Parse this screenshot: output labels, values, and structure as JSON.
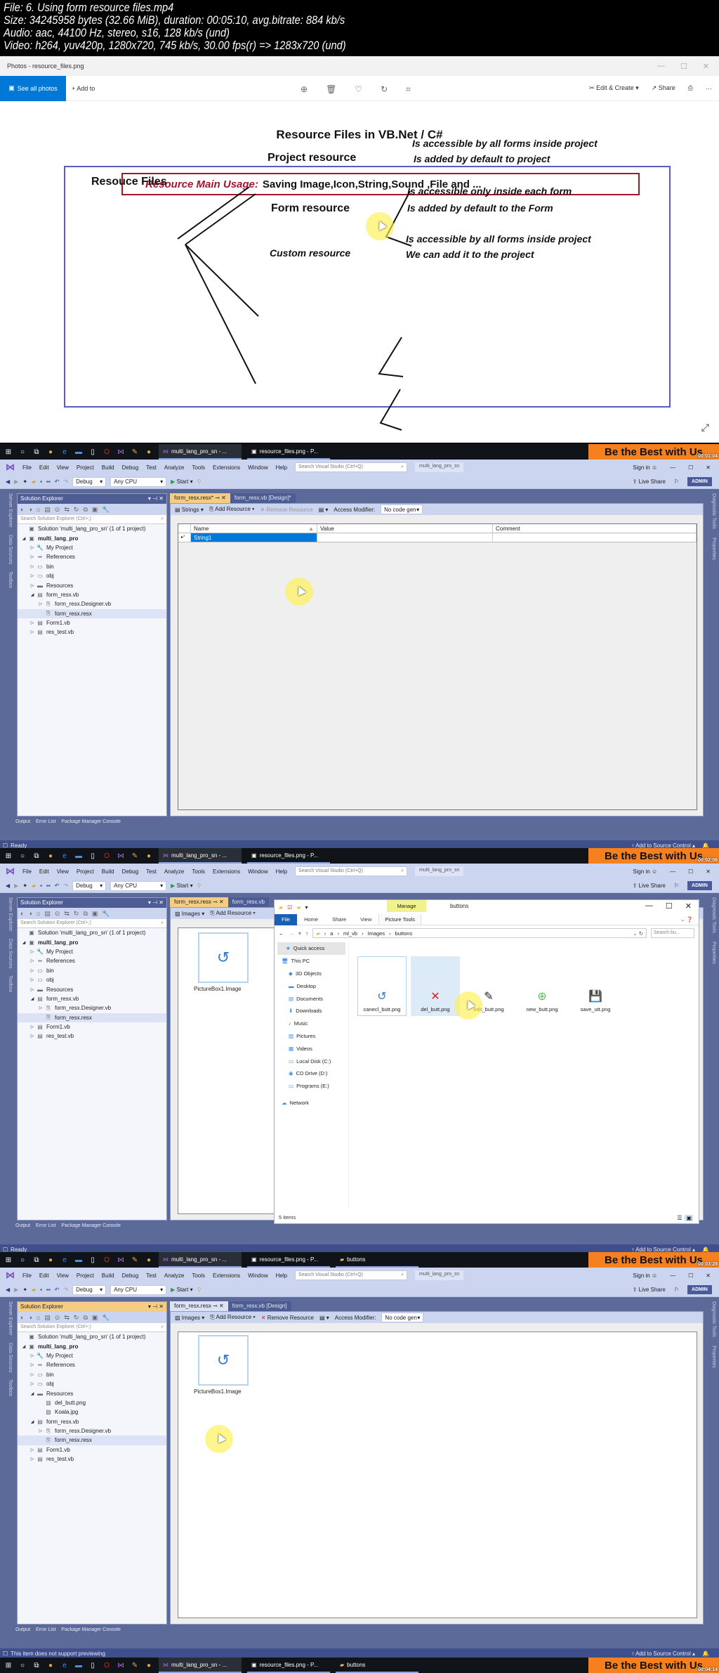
{
  "video_info": {
    "line1": "File: 6. Using form resource files.mp4",
    "line2": "Size: 34245958 bytes (32.66 MiB), duration: 00:05:10, avg.bitrate: 884 kb/s",
    "line3": "Audio: aac, 44100 Hz, stereo, s16, 128 kb/s (und)",
    "line4": "Video: h264, yuv420p, 1280x720, 745 kb/s, 30.00 fps(r) => 1283x720 (und)"
  },
  "photos": {
    "title": "Photos - resource_files.png",
    "see_all": "See all photos",
    "add_to": "+ Add to",
    "edit_create": "Edit & Create",
    "share": "Share",
    "more": "···"
  },
  "slide": {
    "title": "Resource Files in VB.Net / C#",
    "usage_label": "Resource Main Usage:",
    "usage_text": "Saving Image,Icon,String,Sound ,File and  ...",
    "root": "Resouce Files",
    "branches": [
      {
        "name": "Project resource",
        "notes": [
          "Is accessible  by  all forms inside project",
          "Is added by default to project"
        ]
      },
      {
        "name": "Form resource",
        "notes": [
          "Is accessible only inside each form",
          "Is added by default to the Form"
        ]
      },
      {
        "name": "Custom resource",
        "notes": [
          "Is accessible  by  all forms inside project",
          "We can add it to the project"
        ]
      }
    ]
  },
  "taskbar": {
    "apps": [
      "multi_lang_pro_sn - ...",
      "resource_files.png - P...",
      "buttons"
    ],
    "promo": "Be the Best with Us",
    "timestamps": [
      "00:01:04",
      "00:02:06",
      "00:03:28",
      "00:04:14"
    ]
  },
  "vs": {
    "menu": [
      "File",
      "Edit",
      "View",
      "Project",
      "Build",
      "Debug",
      "Test",
      "Analyze",
      "Tools",
      "Extensions",
      "Window",
      "Help"
    ],
    "search_placeholder": "Search Visual Studio (Ctrl+Q)",
    "solution_name": "multi_lang_pro_sn",
    "sign_in": "Sign in",
    "config": "Debug",
    "platform": "Any CPU",
    "start": "Start",
    "live_share": "Live Share",
    "admin": "ADMIN",
    "side_left": [
      "Server Explorer",
      "Data Sources",
      "Toolbox"
    ],
    "side_right": [
      "Diagnostic Tools",
      "Properties"
    ],
    "solution_explorer": "Solution Explorer",
    "se_search": "Search Solution Explorer (Ctrl+;)",
    "bottom_tabs": [
      "Output",
      "Error List",
      "Package Manager Console"
    ],
    "add_source": "Add to Source Control",
    "tree1": [
      {
        "label": "Solution 'multi_lang_pro_sn' (1 of 1 project)",
        "indent": 0,
        "tw": "",
        "icon": "▣"
      },
      {
        "label": "multi_lang_pro",
        "indent": 0,
        "tw": "◢",
        "icon": "▣",
        "bold": true
      },
      {
        "label": "My Project",
        "indent": 1,
        "tw": "▷",
        "icon": "🔧"
      },
      {
        "label": "References",
        "indent": 1,
        "tw": "▷",
        "icon": "▪▪"
      },
      {
        "label": "bin",
        "indent": 1,
        "tw": "▷",
        "icon": "▭"
      },
      {
        "label": "obj",
        "indent": 1,
        "tw": "▷",
        "icon": "▭"
      },
      {
        "label": "Resources",
        "indent": 1,
        "tw": "▷",
        "icon": "▬"
      },
      {
        "label": "form_resx.vb",
        "indent": 1,
        "tw": "◢",
        "icon": "▤"
      },
      {
        "label": "form_resx.Designer.vb",
        "indent": 2,
        "tw": "▷",
        "icon": "⎘"
      },
      {
        "label": "form_resx.resx",
        "indent": 2,
        "tw": "",
        "icon": "⎘",
        "sel": true
      },
      {
        "label": "Form1.vb",
        "indent": 1,
        "tw": "▷",
        "icon": "▤"
      },
      {
        "label": "res_test.vb",
        "indent": 1,
        "tw": "▷",
        "icon": "▤"
      }
    ],
    "tree3": [
      {
        "label": "Solution 'multi_lang_pro_sn' (1 of 1 project)",
        "indent": 0,
        "tw": "",
        "icon": "▣"
      },
      {
        "label": "multi_lang_pro",
        "indent": 0,
        "tw": "◢",
        "icon": "▣",
        "bold": true
      },
      {
        "label": "My Project",
        "indent": 1,
        "tw": "▷",
        "icon": "🔧"
      },
      {
        "label": "References",
        "indent": 1,
        "tw": "▷",
        "icon": "▪▪"
      },
      {
        "label": "bin",
        "indent": 1,
        "tw": "▷",
        "icon": "▭"
      },
      {
        "label": "obj",
        "indent": 1,
        "tw": "▷",
        "icon": "▭"
      },
      {
        "label": "Resources",
        "indent": 1,
        "tw": "◢",
        "icon": "▬"
      },
      {
        "label": "del_butt.png",
        "indent": 2,
        "tw": "",
        "icon": "▨"
      },
      {
        "label": "Koala.jpg",
        "indent": 2,
        "tw": "",
        "icon": "▨"
      },
      {
        "label": "form_resx.vb",
        "indent": 1,
        "tw": "◢",
        "icon": "▤"
      },
      {
        "label": "form_resx.Designer.vb",
        "indent": 2,
        "tw": "▷",
        "icon": "⎘"
      },
      {
        "label": "form_resx.resx",
        "indent": 2,
        "tw": "",
        "icon": "⎘",
        "sel": true
      },
      {
        "label": "Form1.vb",
        "indent": 1,
        "tw": "▷",
        "icon": "▤"
      },
      {
        "label": "res_test.vb",
        "indent": 1,
        "tw": "▷",
        "icon": "▤"
      }
    ]
  },
  "frame1": {
    "tabs": [
      "form_resx.resx*",
      "form_resx.vb [Design]*"
    ],
    "resource_type": "Strings",
    "add_resource": "Add Resource",
    "remove_resource": "Remove Resource",
    "access_modifier_label": "Access Modifier:",
    "access_modifier_value": "No code gen",
    "columns": [
      "Name",
      "Value",
      "Comment"
    ],
    "rows": [
      {
        "marker": "▸*",
        "name": "String1",
        "value": "",
        "comment": ""
      }
    ],
    "status": "Ready"
  },
  "frame2": {
    "tabs": [
      "form_resx.resx",
      "form_resx.vb"
    ],
    "resource_type": "Images",
    "add_resource": "Add Resource",
    "picture_label": "PictureBox1.Image",
    "status": "Ready",
    "explorer": {
      "title": "buttons",
      "manage": "Manage",
      "ribbon": [
        "File",
        "Home",
        "Share",
        "View",
        "Picture Tools"
      ],
      "path": [
        "a",
        "ml_vb",
        "Images",
        "buttons"
      ],
      "search_placeholder": "Search bu...",
      "nav": [
        {
          "label": "Quick access",
          "icon": "★",
          "indent": 0
        },
        {
          "label": "This PC",
          "icon": "🖥",
          "indent": 0
        },
        {
          "label": "3D Objects",
          "icon": "◆",
          "indent": 1
        },
        {
          "label": "Desktop",
          "icon": "▬",
          "indent": 1
        },
        {
          "label": "Documents",
          "icon": "▤",
          "indent": 1
        },
        {
          "label": "Downloads",
          "icon": "⬇",
          "indent": 1
        },
        {
          "label": "Music",
          "icon": "♪",
          "indent": 1
        },
        {
          "label": "Pictures",
          "icon": "▨",
          "indent": 1
        },
        {
          "label": "Videos",
          "icon": "▦",
          "indent": 1
        },
        {
          "label": "Local Disk (C:)",
          "icon": "▭",
          "indent": 1
        },
        {
          "label": "CD Drive (D:)",
          "icon": "◉",
          "indent": 1
        },
        {
          "label": "Programs (E:)",
          "icon": "▭",
          "indent": 1
        },
        {
          "label": "Network",
          "icon": "☁",
          "indent": 0
        }
      ],
      "files": [
        {
          "name": "canecl_butt.png",
          "glyph": "↺",
          "color": "#2b7bd6"
        },
        {
          "name": "del_butt.png",
          "glyph": "✕",
          "color": "#e02020"
        },
        {
          "name": "edit_butt.png",
          "glyph": "✎",
          "color": "#222222"
        },
        {
          "name": "new_butt.png",
          "glyph": "⊕",
          "color": "#5cb85c"
        },
        {
          "name": "save_utt.png",
          "glyph": "💾",
          "color": "#2b7bd6"
        }
      ],
      "item_count": "5 items"
    }
  },
  "frame3": {
    "tabs": [
      "form_resx.resx",
      "form_resx.vb [Design]"
    ],
    "resource_type": "Images",
    "add_resource": "Add Resource",
    "remove_resource": "Remove Resource",
    "access_modifier_label": "Access Modifier:",
    "access_modifier_value": "No code gen",
    "picture_label": "PictureBox1.Image",
    "status": "This item does not support previewing"
  },
  "colors": {
    "accent_blue": "#0078d7",
    "vs_chrome": "#ccd5f0",
    "vs_dark": "#5c6a99",
    "promo_orange": "#f7801e",
    "slide_red": "#a01830",
    "slide_border": "#5b5bc8"
  }
}
